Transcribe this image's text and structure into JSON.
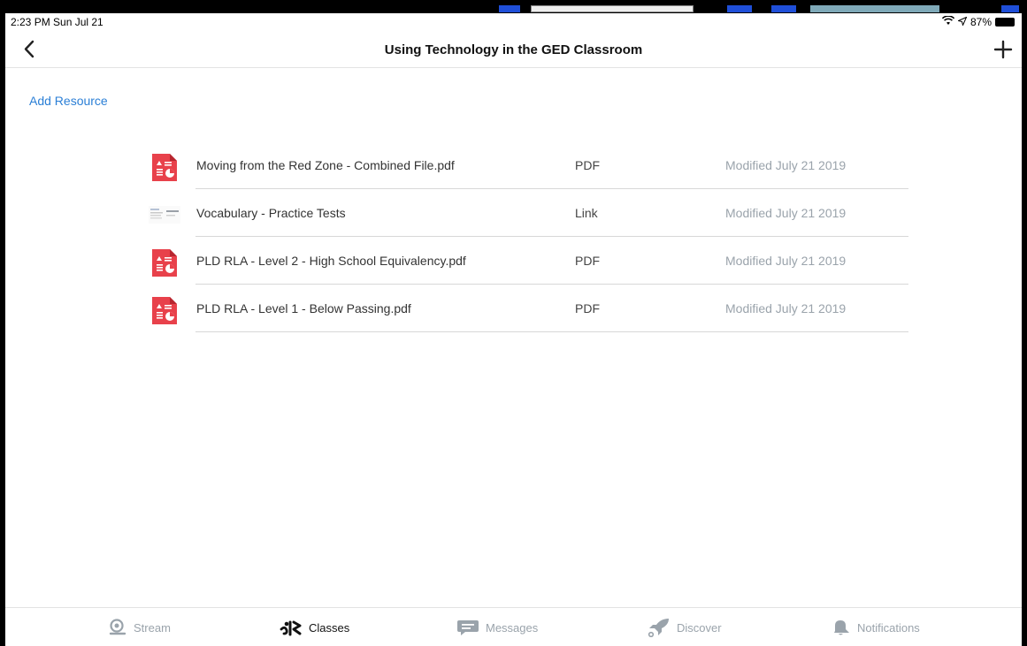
{
  "status": {
    "time_date": "2:23 PM  Sun Jul 21",
    "battery": "87%"
  },
  "nav": {
    "title": "Using Technology in the GED Classroom"
  },
  "add_resource_label": "Add Resource",
  "resources": [
    {
      "name": "Moving from the Red Zone - Combined File.pdf",
      "type": "PDF",
      "modified": "Modified July 21 2019",
      "icon": "pdf-icon"
    },
    {
      "name": "Vocabulary - Practice Tests",
      "type": "Link",
      "modified": "Modified July 21 2019",
      "icon": "link-thumbnail"
    },
    {
      "name": "PLD RLA - Level 2 - High School Equivalency.pdf",
      "type": "PDF",
      "modified": "Modified July 21 2019",
      "icon": "pdf-icon"
    },
    {
      "name": "PLD RLA - Level 1 - Below Passing.pdf",
      "type": "PDF",
      "modified": "Modified July 21 2019",
      "icon": "pdf-icon"
    }
  ],
  "tabs": [
    {
      "label": "Stream",
      "icon": "stream-icon",
      "active": false
    },
    {
      "label": "Classes",
      "icon": "classes-icon",
      "active": true
    },
    {
      "label": "Messages",
      "icon": "messages-icon",
      "active": false
    },
    {
      "label": "Discover",
      "icon": "rocket-icon",
      "active": false
    },
    {
      "label": "Notifications",
      "icon": "bell-icon",
      "active": false
    }
  ],
  "colors": {
    "accent": "#2b7fd6",
    "pdf_red": "#e8414b",
    "muted": "#9aa3ab"
  }
}
